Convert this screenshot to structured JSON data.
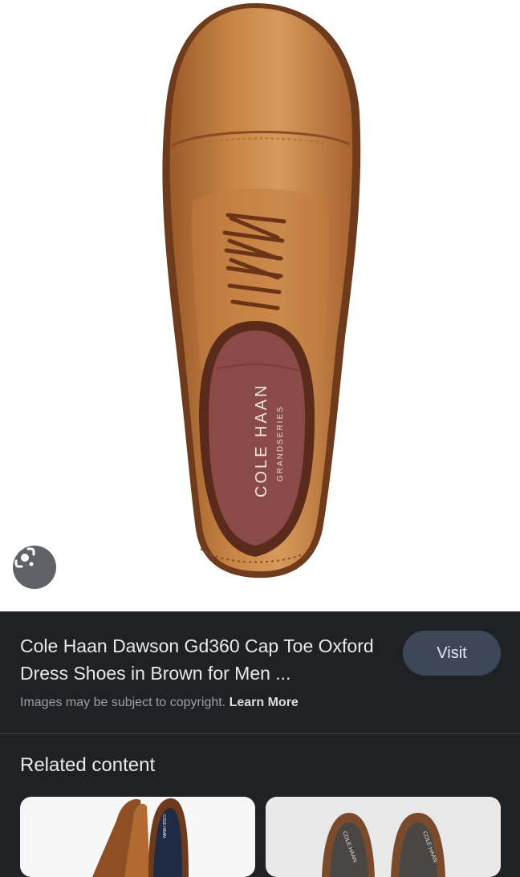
{
  "hero": {
    "logo_main": "COLE HAAN",
    "logo_sub": "GRANDSERIES"
  },
  "result": {
    "title": "Cole Haan Dawson Gd360 Cap Toe Oxford Dress Shoes in Brown for Men ...",
    "visit_label": "Visit",
    "copyright_text": "Images may be subject to copyright.",
    "learn_more": "Learn More"
  },
  "related": {
    "heading": "Related content",
    "cards": [
      {
        "logo_text": "COLE HAAN"
      },
      {
        "logo_text_left": "COLE HAAN",
        "logo_text_right": "COLE HAAN"
      }
    ]
  }
}
